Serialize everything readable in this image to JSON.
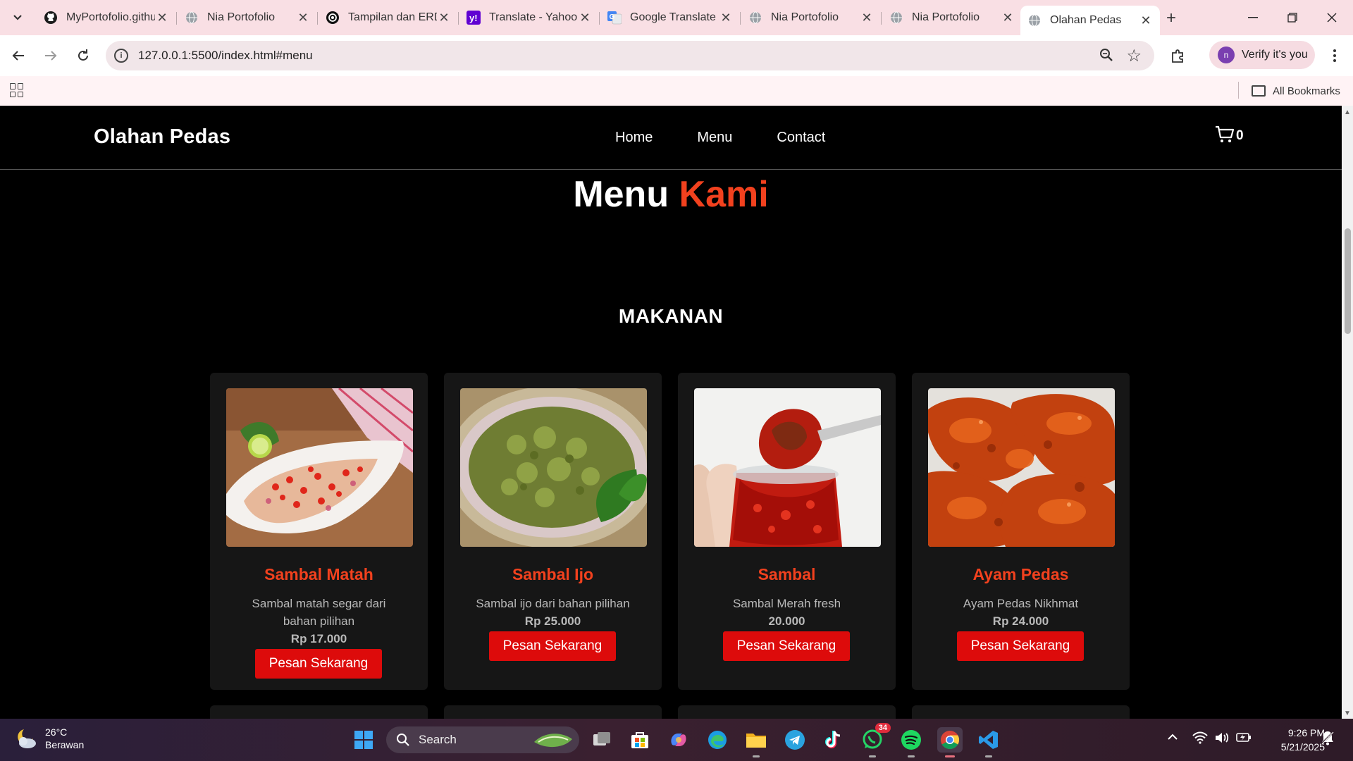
{
  "browser": {
    "tabs": [
      {
        "title": "MyPortofolio.github.io",
        "icon": "github-icon",
        "active": false
      },
      {
        "title": "Nia Portofolio",
        "icon": "globe-icon",
        "active": false
      },
      {
        "title": "Tampilan dan ERD",
        "icon": "chatgpt-icon",
        "active": false
      },
      {
        "title": "Translate - Yahoo",
        "icon": "yahoo-icon",
        "active": false
      },
      {
        "title": "Google Translate",
        "icon": "google-translate-icon",
        "active": false
      },
      {
        "title": "Nia Portofolio",
        "icon": "globe-icon",
        "active": false
      },
      {
        "title": "Nia Portofolio",
        "icon": "globe-icon",
        "active": false
      },
      {
        "title": "Olahan Pedas",
        "icon": "globe-icon",
        "active": true
      }
    ],
    "url": "127.0.0.1:5500/index.html#menu",
    "profile_label": "Verify it's you",
    "profile_initial": "n",
    "all_bookmarks": "All Bookmarks"
  },
  "site": {
    "brand": "Olahan Pedas",
    "nav": [
      "Home",
      "Menu",
      "Contact"
    ],
    "cart_count": "0",
    "section_title_main": "Menu",
    "section_title_accent": "Kami",
    "category": "MAKANAN",
    "accent_color": "#f2411e",
    "button_color": "#dd0b0b",
    "items": [
      {
        "name": "Sambal Matah",
        "desc": "Sambal matah segar dari bahan pilihan",
        "price": "Rp 17.000",
        "button": "Pesan Sekarang"
      },
      {
        "name": "Sambal Ijo",
        "desc": "Sambal ijo dari bahan pilihan",
        "price": "Rp 25.000",
        "button": "Pesan Sekarang"
      },
      {
        "name": "Sambal",
        "desc": "Sambal Merah fresh",
        "price": "20.000",
        "button": "Pesan Sekarang"
      },
      {
        "name": "Ayam Pedas",
        "desc": "Ayam Pedas Nikhmat",
        "price": "Rp 24.000",
        "button": "Pesan Sekarang"
      }
    ]
  },
  "taskbar": {
    "temperature": "26°C",
    "weather": "Berawan",
    "search": "Search",
    "whatsapp_badge": "34",
    "time": "9:26 PM",
    "date": "5/21/2025"
  }
}
